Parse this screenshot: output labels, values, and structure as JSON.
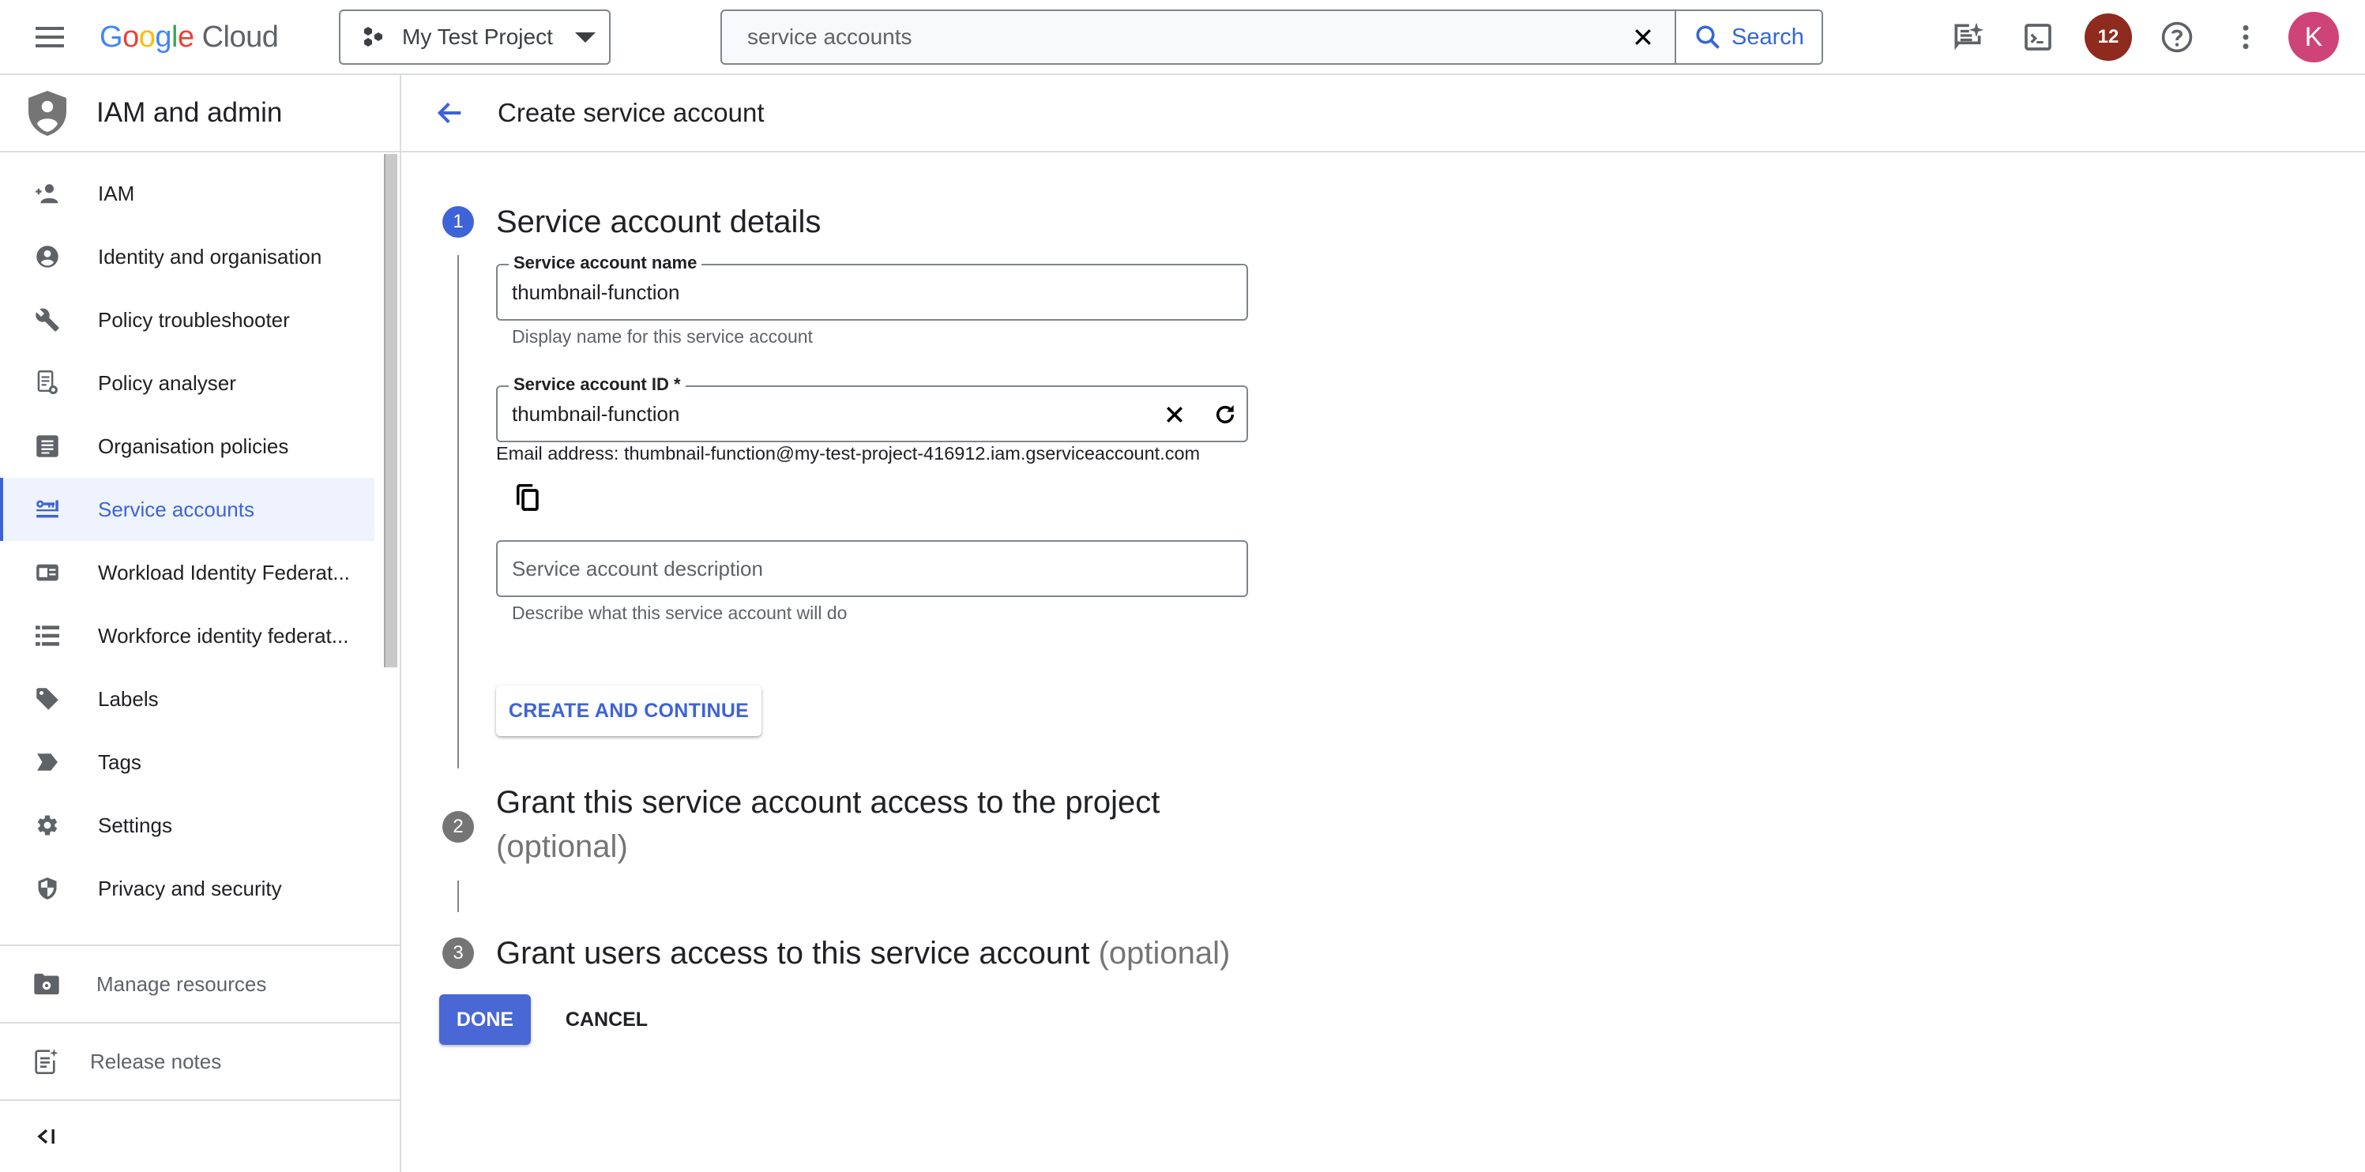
{
  "header": {
    "logo": {
      "google": "Google",
      "cloud": "Cloud"
    },
    "project": {
      "label": "My Test Project"
    },
    "search": {
      "value": "service accounts",
      "button_label": "Search"
    },
    "notifications_count": "12",
    "avatar_initial": "K",
    "icons": [
      "menu-icon",
      "project-hex-icon",
      "chevron-down-icon",
      "clear-icon",
      "search-icon",
      "gemini-chat-icon",
      "cloud-shell-icon",
      "help-icon",
      "more-vert-icon"
    ]
  },
  "sidebar": {
    "title": "IAM and admin",
    "items": [
      {
        "label": "IAM",
        "icon": "person-add-icon",
        "active": false
      },
      {
        "label": "Identity and organisation",
        "icon": "account-circle-icon",
        "active": false
      },
      {
        "label": "Policy troubleshooter",
        "icon": "wrench-icon",
        "active": false
      },
      {
        "label": "Policy analyser",
        "icon": "policy-analyzer-icon",
        "active": false
      },
      {
        "label": "Organisation policies",
        "icon": "article-icon",
        "active": false
      },
      {
        "label": "Service accounts",
        "icon": "service-account-key-icon",
        "active": true
      },
      {
        "label": "Workload Identity Federat...",
        "icon": "id-card-icon",
        "active": false
      },
      {
        "label": "Workforce identity federat...",
        "icon": "list-icon",
        "active": false
      },
      {
        "label": "Labels",
        "icon": "label-tag-icon",
        "active": false
      },
      {
        "label": "Tags",
        "icon": "tag-chevron-icon",
        "active": false
      },
      {
        "label": "Settings",
        "icon": "gear-icon",
        "active": false
      },
      {
        "label": "Privacy and security",
        "icon": "shield-half-icon",
        "active": false
      }
    ],
    "manage_resources": "Manage resources",
    "release_notes": "Release notes",
    "collapse_label": "<|"
  },
  "page": {
    "title": "Create service account",
    "steps": [
      {
        "number": "1",
        "title": "Service account details",
        "optional": "",
        "state": "active"
      },
      {
        "number": "2",
        "title": "Grant this service account access to the project",
        "optional": "(optional)",
        "state": "inactive"
      },
      {
        "number": "3",
        "title": "Grant users access to this service account",
        "optional": "(optional)",
        "state": "inactive"
      }
    ],
    "form": {
      "name": {
        "label": "Service account name",
        "value": "thumbnail-function",
        "hint": "Display name for this service account"
      },
      "id": {
        "label": "Service account ID *",
        "value": "thumbnail-function"
      },
      "email_text": "Email address: thumbnail-function@my-test-project-416912.iam.gserviceaccount.com",
      "description": {
        "placeholder": "Service account description",
        "value": "",
        "hint": "Describe what this service account will do"
      }
    },
    "buttons": {
      "create_continue": "CREATE AND CONTINUE",
      "done": "DONE",
      "cancel": "CANCEL"
    }
  },
  "colors": {
    "accent": "#3e63d8",
    "done_button": "#4a67d6",
    "badge": "#8f2a1e",
    "avatar": "#cf4478",
    "active_nav_bg": "#eef3fd"
  }
}
